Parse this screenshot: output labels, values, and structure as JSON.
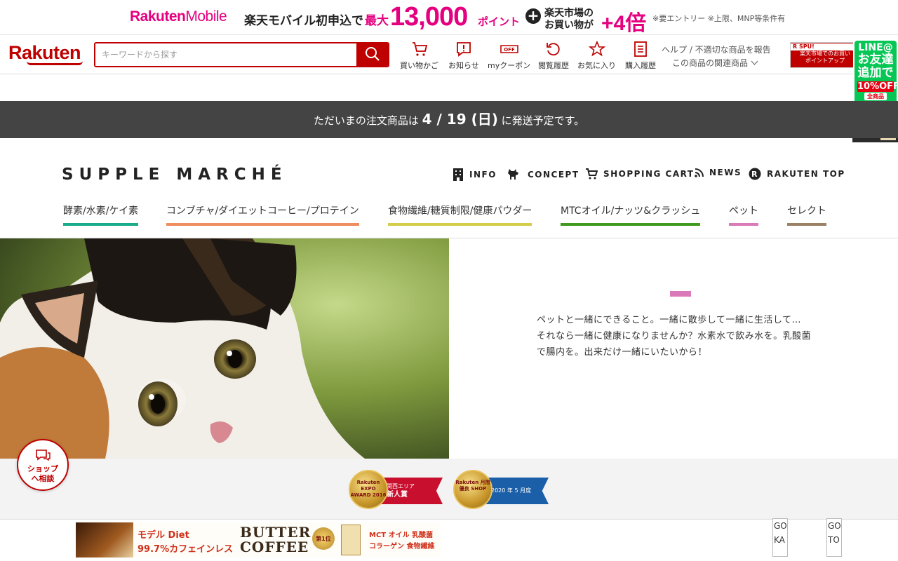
{
  "promo_banner": {
    "brand": "Rakuten",
    "brand_suffix": "Mobile",
    "text_1": "楽天モバイル初申込で",
    "max_label": "最大",
    "points_number": "13,000",
    "points_unit": "ポイント",
    "plus_symbol": "+",
    "market_line_1": "楽天市場の",
    "market_line_2": "お買い物が",
    "multiplier": "+4倍",
    "note": "※要エントリー ※上限、MNP等条件有"
  },
  "header": {
    "logo": "Rakuten",
    "search": {
      "placeholder": "キーワードから探す",
      "value": ""
    },
    "nav": [
      {
        "label": "買い物かご",
        "icon": "cart-icon"
      },
      {
        "label": "お知らせ",
        "icon": "notice-icon"
      },
      {
        "label": "myクーポン",
        "icon": "coupon-icon"
      },
      {
        "label": "閲覧履歴",
        "icon": "history-icon"
      },
      {
        "label": "お気に入り",
        "icon": "star-icon"
      },
      {
        "label": "購入履歴",
        "icon": "receipt-icon"
      }
    ],
    "coupon_icon_text": "OFF",
    "help_link": "ヘルプ / 不適切な商品を報告",
    "related_link": "この商品の関連商品",
    "spu_banner": {
      "tag": "R SPU!",
      "line_1": "楽天市場でのお買い",
      "line_2": "ポイントアップ"
    }
  },
  "line_badge": {
    "line_1": "LINE@",
    "line_2": "お友達",
    "line_3": "追加で",
    "offer": "10%OFF",
    "sub_1": "全商品",
    "sub_2": "初回"
  },
  "shipping_notice": {
    "prefix": "ただいまの注文商品は",
    "date": "4 / 19 (日)",
    "suffix": "に発送予定です。"
  },
  "shop": {
    "logo": "SUPPLE MARCHÉ",
    "nav": [
      {
        "label": "INFO",
        "icon": "building-icon"
      },
      {
        "label": "CONCEPT",
        "icon": "dog-icon"
      },
      {
        "label": "SHOPPING CART",
        "icon": "cart-icon"
      },
      {
        "label": "NEWS",
        "icon": "rss-icon"
      },
      {
        "label": "RAKUTEN TOP",
        "icon": "rakuten-r-icon"
      }
    ],
    "rakuten_icon_letter": "R",
    "categories": [
      {
        "label": "酵素/水素/ケイ素",
        "color": "#1aab8a"
      },
      {
        "label": "コンブチャ/ダイエットコーヒー/プロテイン",
        "color": "#ef8d5e"
      },
      {
        "label": "食物繊維/糖質制限/健康パウダー",
        "color": "#d4cd4a"
      },
      {
        "label": "MTCオイル/ナッツ&クラッシュ",
        "color": "#3f9a1e"
      },
      {
        "label": "ペット",
        "color": "#db7ab9"
      },
      {
        "label": "セレクト",
        "color": "#9c8064"
      }
    ]
  },
  "hero": {
    "image": "calico-kitten-photo",
    "accent_color": "#db7ab9",
    "text_lines": [
      "ペットと一緒にできること。一緒に散歩して一緒に生活して…",
      "それなら一緒に健康になりませんか？水素水で飲み水を。乳酸菌",
      "で腸内を。出来だけ一緒にいたいから！"
    ]
  },
  "awards": [
    {
      "medal": "Rakuten EXPO AWARD 2016",
      "ribbon_small": "関西エリア",
      "ribbon": "新人賞",
      "color": "#c8102e"
    },
    {
      "medal": "Rakuten 月間優良 SHOP",
      "ribbon_small": "",
      "ribbon": "2020 年 5 月度",
      "color": "#1a5fa8"
    }
  ],
  "bottom_ad": {
    "line_1": "モデル Diet",
    "line_2": "99.7%カフェインレス",
    "title_1": "BUTTER",
    "title_2": "COFFEE",
    "medal_text": "第1位",
    "tag_1": "MCT オイル 乳酸菌",
    "tag_2": "コラーゲン 食物繊維"
  },
  "goto_buttons": [
    {
      "line_1": "GO",
      "line_2": "KA"
    },
    {
      "line_1": "GO",
      "line_2": "TO"
    }
  ],
  "chat": {
    "line_1": "ショップ",
    "line_2": "へ相談"
  }
}
